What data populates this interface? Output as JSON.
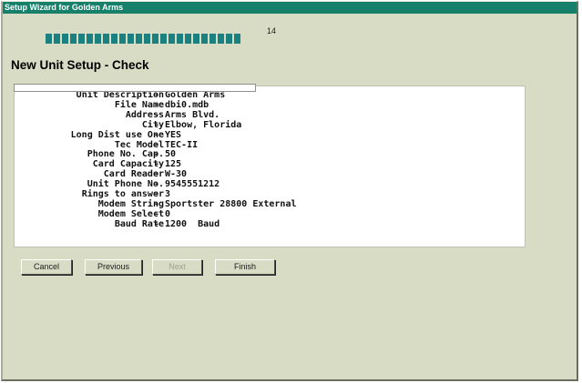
{
  "window": {
    "title": "Setup Wizard for Golden Arms"
  },
  "progress": {
    "count": "14",
    "filled_segments": 24
  },
  "page": {
    "heading": "New Unit Setup - Check"
  },
  "details": {
    "rows": [
      {
        "label": "Unit Description",
        "sep": "-",
        "value": "Golden Arms"
      },
      {
        "label": "File Name",
        "sep": "-",
        "value": "dbi0.mdb"
      },
      {
        "label": "Address",
        "sep": "-",
        "value": "Arms Blvd."
      },
      {
        "label": "City",
        "sep": "-",
        "value": "Elbow, Florida"
      },
      {
        "label": "Long Dist use One",
        "sep": "-",
        "value": "YES"
      },
      {
        "label": "Tec Model",
        "sep": "-",
        "value": "TEC-II"
      },
      {
        "label": "Phone No. Cap.",
        "sep": "-",
        "value": "50"
      },
      {
        "label": "Card Capacity",
        "sep": "-",
        "value": "125"
      },
      {
        "label": "Card Reader",
        "sep": "-",
        "value": "W-30"
      },
      {
        "label": "Unit Phone No.",
        "sep": "-",
        "value": "9545551212"
      },
      {
        "label": "Rings to answer",
        "sep": "-",
        "value": "3"
      },
      {
        "label": "Modem String",
        "sep": "-",
        "value": "Sportster 28800 External"
      },
      {
        "label": "Modem Select",
        "sep": "-",
        "value": "0"
      },
      {
        "label": "Baud Rate",
        "sep": "-",
        "value": "1200  Baud"
      }
    ]
  },
  "buttons": {
    "cancel": "Cancel",
    "previous": "Previous",
    "next": "Next",
    "finish": "Finish"
  },
  "colors": {
    "title_bar": "#17806a",
    "progress": "#1a8080",
    "window_bg": "#d8dcc4"
  }
}
